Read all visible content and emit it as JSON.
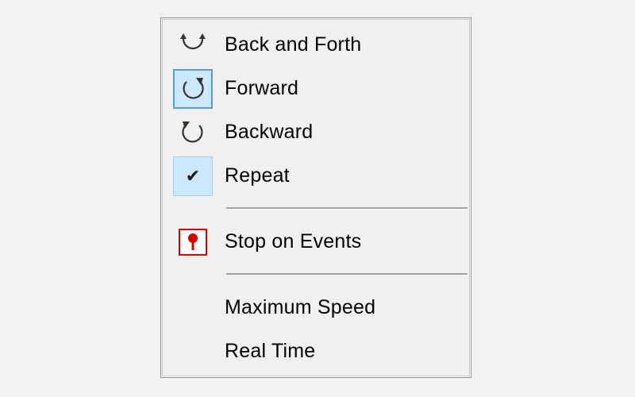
{
  "menu": {
    "items": [
      {
        "label": "Back and Forth",
        "icon": "back-and-forth-icon"
      },
      {
        "label": "Forward",
        "icon": "forward-loop-icon",
        "selected": true
      },
      {
        "label": "Backward",
        "icon": "backward-loop-icon"
      },
      {
        "label": "Repeat",
        "icon": "check-icon",
        "checked": true
      }
    ],
    "stop_item": {
      "label": "Stop on Events",
      "icon": "stop-pin-icon"
    },
    "speed_items": [
      {
        "label": "Maximum Speed"
      },
      {
        "label": "Real Time"
      }
    ],
    "check_glyph": "✔"
  },
  "colors": {
    "selected_bg": "#cce8ff",
    "selected_border": "#5b9bd5",
    "stop_red": "#d60000"
  }
}
